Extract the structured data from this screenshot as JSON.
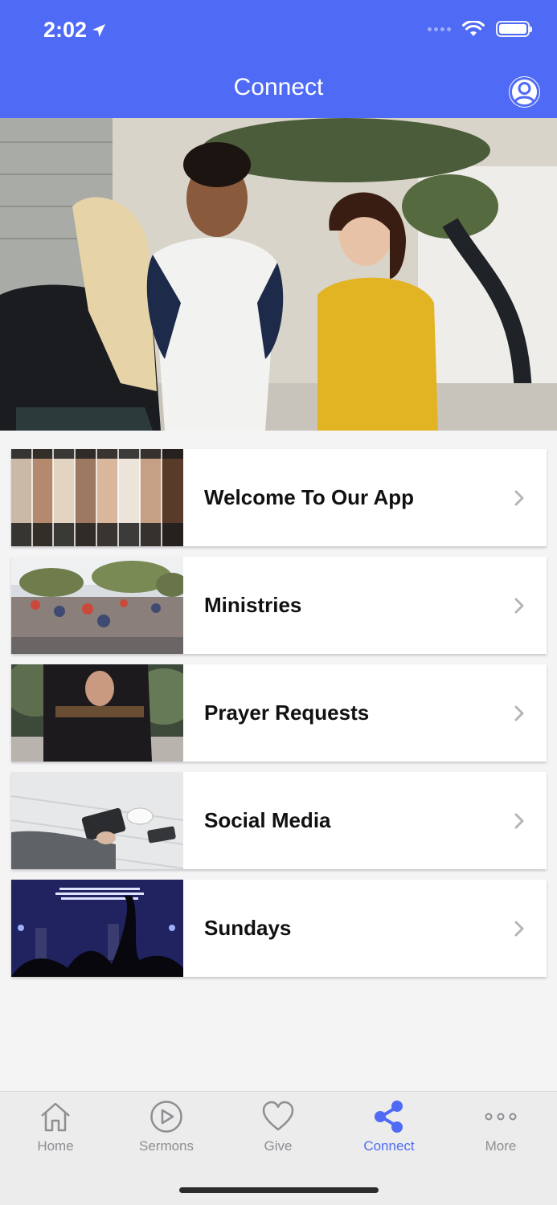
{
  "status_bar": {
    "time": "2:02"
  },
  "header": {
    "title": "Connect"
  },
  "list": [
    {
      "label": "Welcome To Our App",
      "icon": "chevron-right-icon"
    },
    {
      "label": "Ministries",
      "icon": "chevron-right-icon"
    },
    {
      "label": "Prayer Requests",
      "icon": "chevron-right-icon"
    },
    {
      "label": "Social Media",
      "icon": "chevron-right-icon"
    },
    {
      "label": "Sundays",
      "icon": "chevron-right-icon"
    }
  ],
  "tabs": [
    {
      "label": "Home",
      "icon": "home-icon"
    },
    {
      "label": "Sermons",
      "icon": "play-circle-icon"
    },
    {
      "label": "Give",
      "icon": "heart-icon"
    },
    {
      "label": "Connect",
      "icon": "share-icon",
      "active": true
    },
    {
      "label": "More",
      "icon": "more-dots-icon"
    }
  ],
  "colors": {
    "accent": "#4f6bf5",
    "inactive": "#8e8e93"
  }
}
